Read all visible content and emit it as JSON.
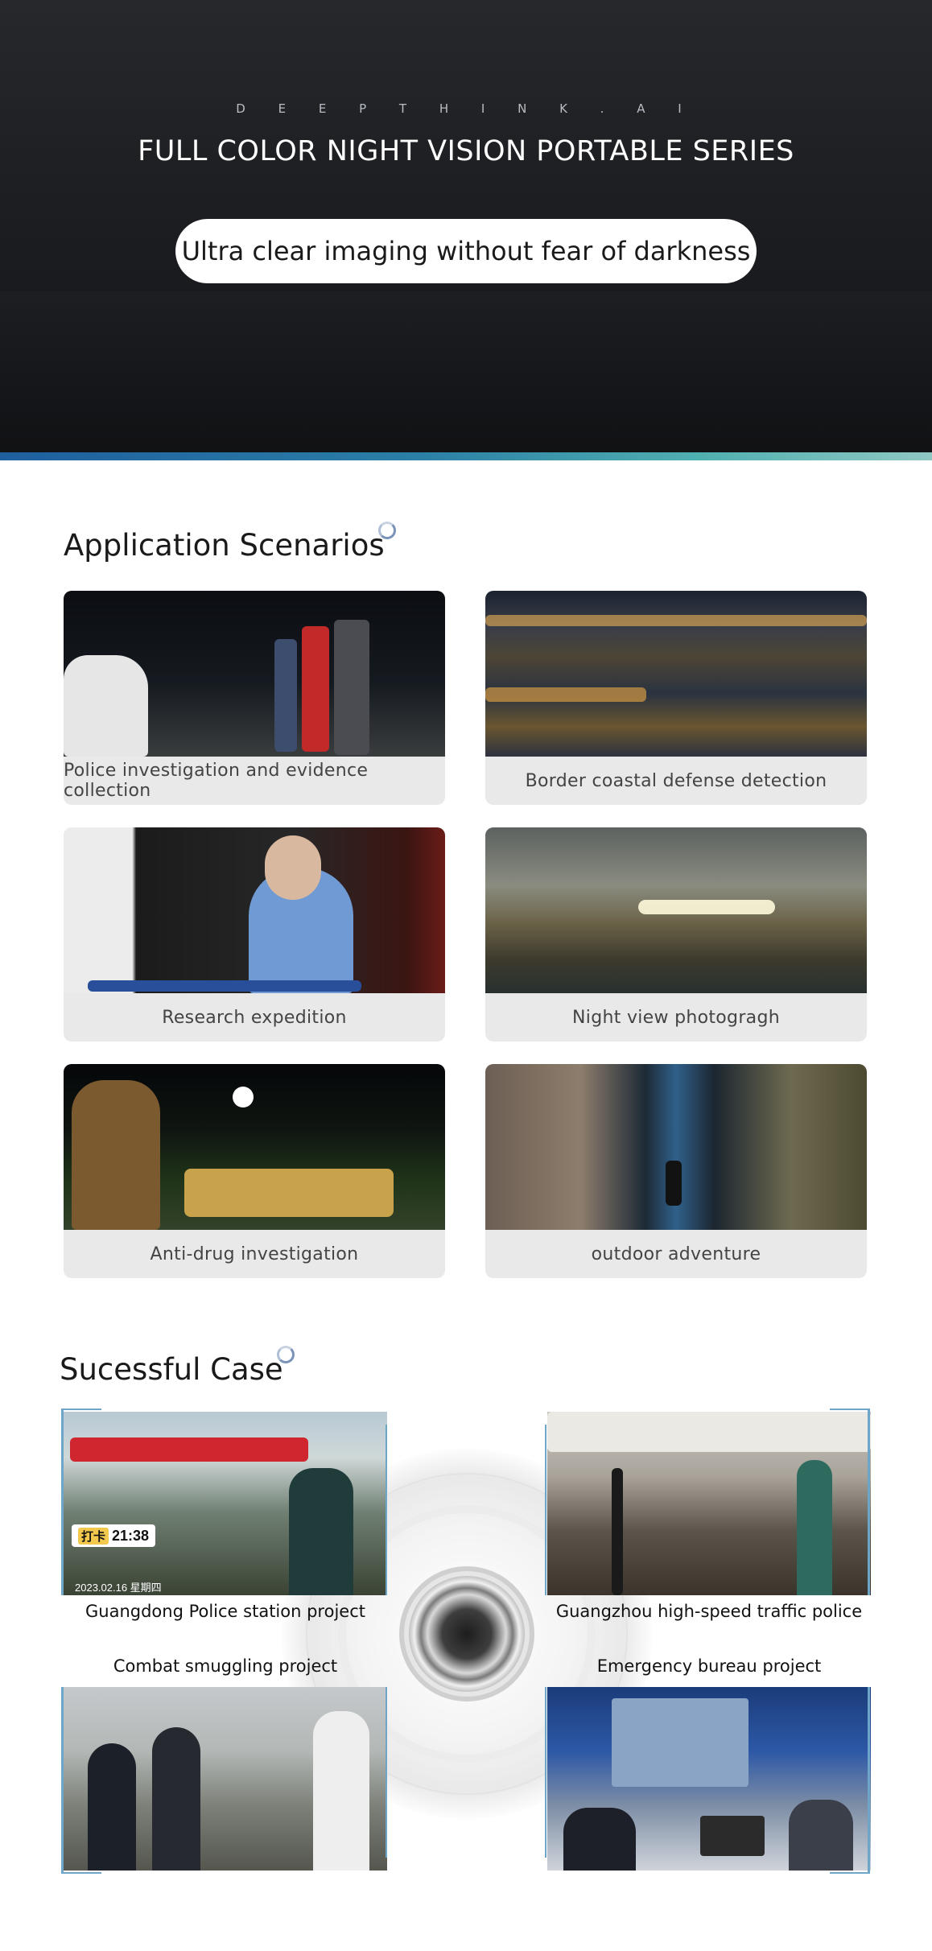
{
  "hero": {
    "brand": "D E E P T H I N K . A I",
    "title": "FULL COLOR NIGHT VISION PORTABLE SERIES",
    "tagline": "Ultra clear imaging without fear of darkness"
  },
  "scenarios": {
    "title": "Application Scenarios",
    "items": [
      {
        "label": "Police investigation and evidence collection"
      },
      {
        "label": "Border coastal defense detection"
      },
      {
        "label": "Research expedition"
      },
      {
        "label": "Night view photogragh"
      },
      {
        "label": "Anti-drug investigation"
      },
      {
        "label": "outdoor adventure"
      }
    ]
  },
  "cases": {
    "title": "Sucessful Case",
    "items": [
      {
        "label": "Guangdong Police station project",
        "badge_tag": "打卡",
        "badge_time": "21:38",
        "date": "2023.02.16 星期四"
      },
      {
        "label": "Guangzhou high-speed traffic police"
      },
      {
        "label": "Combat smuggling project"
      },
      {
        "label": "Emergency bureau project"
      }
    ]
  },
  "colors": {
    "hero_bg": "#1c1e22",
    "stripe_start": "#1f5f9e",
    "stripe_end": "#8fc7c3",
    "card_bg": "#e9e9e9",
    "frame_accent": "#6da6c9"
  }
}
